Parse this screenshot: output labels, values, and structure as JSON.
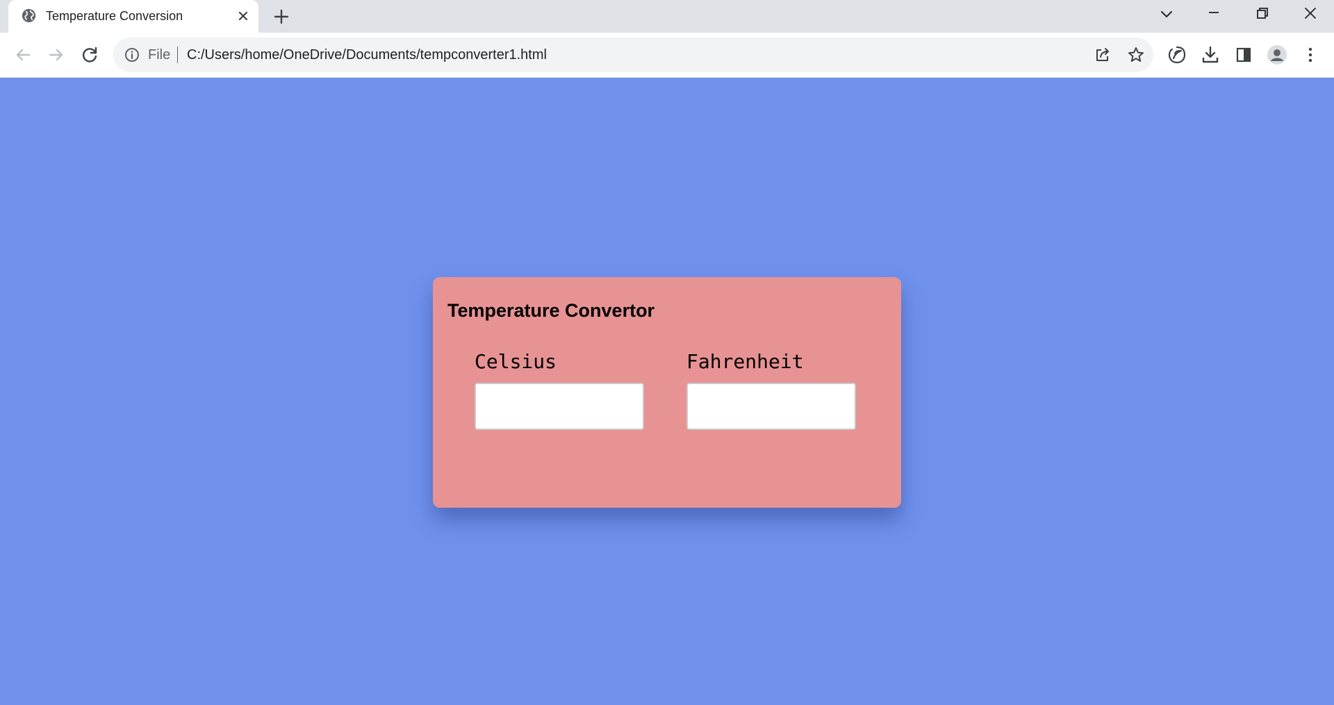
{
  "browser": {
    "tab": {
      "title": "Temperature Conversion",
      "favicon": "globe-icon"
    },
    "omnibox": {
      "scheme_label": "File",
      "url": "C:/Users/home/OneDrive/Documents/tempconverter1.html"
    },
    "icons": {
      "tab_close": "close-icon",
      "new_tab": "plus-icon",
      "tab_search": "chevron-down-icon",
      "minimize": "minimize-icon",
      "restore": "restore-icon",
      "close_window": "close-icon",
      "back": "arrow-left-icon",
      "forward": "arrow-right-icon",
      "reload": "reload-icon",
      "site_info": "info-icon",
      "share": "share-icon",
      "bookmark": "star-icon",
      "extension": "leaf-icon",
      "downloads": "download-icon",
      "side_panel": "side-panel-icon",
      "profile": "avatar-icon",
      "menu": "kebab-menu-icon"
    }
  },
  "page": {
    "background_color": "#6f91ec",
    "card_color": "#e79293",
    "title": "Temperature Convertor",
    "celsius": {
      "label": "Celsius",
      "value": "",
      "placeholder": ""
    },
    "fahrenheit": {
      "label": "Fahrenheit",
      "value": "",
      "placeholder": ""
    }
  }
}
